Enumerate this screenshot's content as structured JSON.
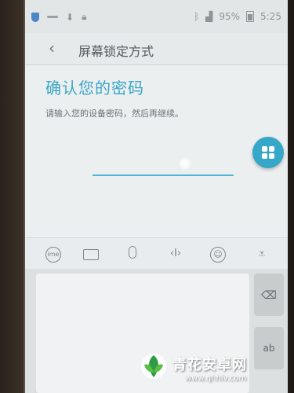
{
  "status_bar": {
    "battery": "95%",
    "time": "5:25",
    "icons": [
      "shield-icon",
      "dash-icon",
      "download-icon",
      "lock-icon",
      "bluetooth-icon",
      "signal-icon",
      "battery-icon"
    ]
  },
  "header": {
    "back_icon": "chevron-left-icon",
    "back_glyph": "‹",
    "title": "屏幕锁定方式"
  },
  "content": {
    "title": "确认您的密码",
    "instruction": "请输入您的设备密码，然后再继续。",
    "password_value": "",
    "accent_color": "#3aa6c6"
  },
  "fab": {
    "icon": "grid-icon"
  },
  "keyboard_toolbar": {
    "ime_label": "ime",
    "items": [
      "ime-icon",
      "keyboard-icon",
      "mic-icon",
      "cursor-move-icon",
      "smile-icon",
      "collapse-icon"
    ],
    "cursor_glyph": "‹I›",
    "smile_glyph": "☺",
    "collapse_glyph": "⩡"
  },
  "keyboard": {
    "backspace_glyph": "⌫",
    "ab_label": "ab"
  },
  "watermark": {
    "title": "青花安卓网",
    "url": "www.qhhlv.com"
  }
}
